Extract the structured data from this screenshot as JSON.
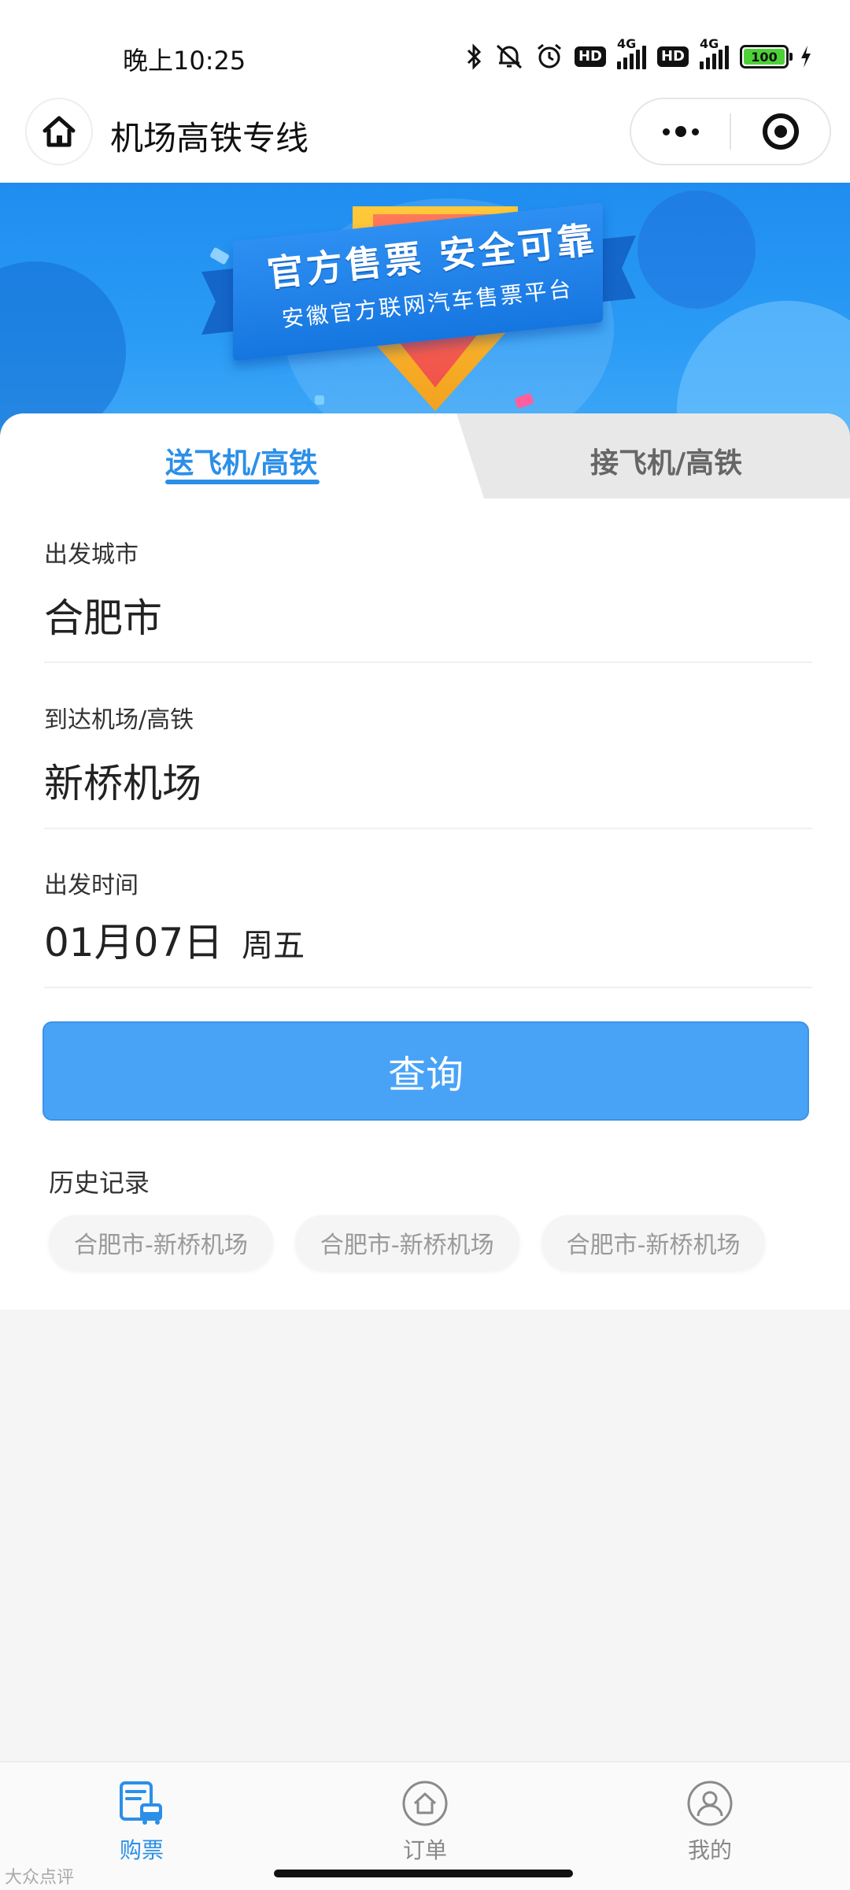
{
  "status_bar": {
    "time": "晚上10:25",
    "hd_label": "HD",
    "network_label": "4G",
    "battery_level": "100"
  },
  "nav": {
    "title": "机场高铁专线"
  },
  "banner": {
    "title": "官方售票  安全可靠",
    "subtitle": "安徽官方联网汽车售票平台"
  },
  "tabs": [
    {
      "label": "送飞机/高铁",
      "active": true
    },
    {
      "label": "接飞机/高铁",
      "active": false
    }
  ],
  "form": {
    "departure_label": "出发城市",
    "departure_value": "合肥市",
    "arrival_label": "到达机场/高铁",
    "arrival_value": "新桥机场",
    "time_label": "出发时间",
    "date_value": "01月07日",
    "weekday_value": "周五",
    "query_label": "查询"
  },
  "history": {
    "title": "历史记录",
    "items": [
      "合肥市-新桥机场",
      "合肥市-新桥机场",
      "合肥市-新桥机场"
    ]
  },
  "tab_bar": {
    "items": [
      {
        "label": "购票",
        "icon": "ticket-bus-icon",
        "active": true
      },
      {
        "label": "订单",
        "icon": "home-outline-icon",
        "active": false
      },
      {
        "label": "我的",
        "icon": "user-icon",
        "active": false
      }
    ]
  },
  "watermark": "大众点评",
  "colors": {
    "accent": "#2b8fe8",
    "button": "#48a3f7",
    "banner": "#1f8df0"
  }
}
